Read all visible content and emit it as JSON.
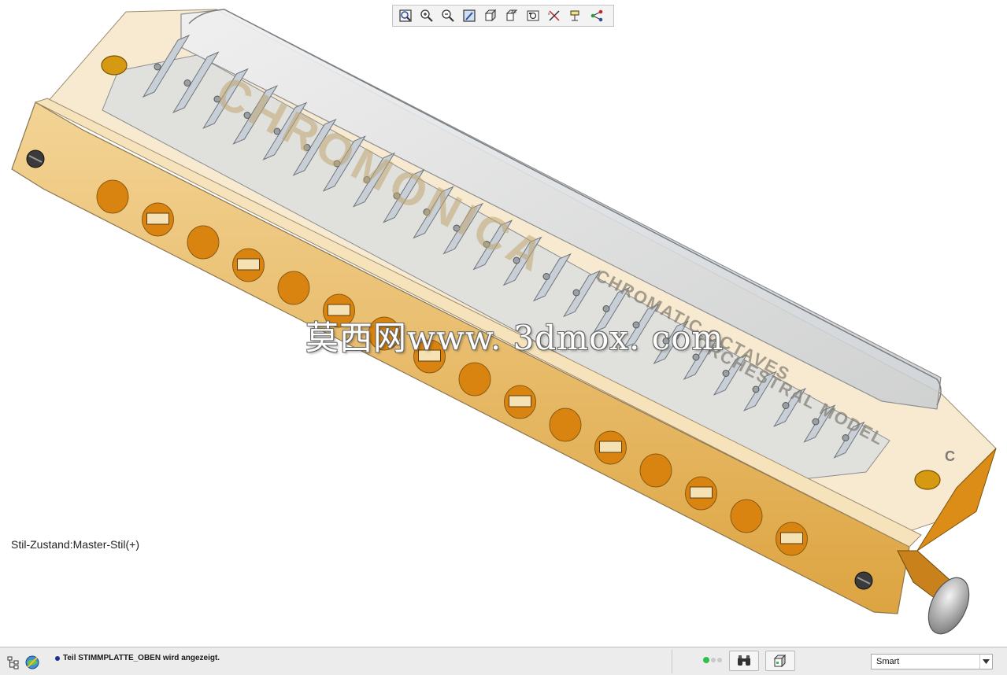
{
  "toolbar": {
    "buttons": [
      {
        "name": "refit-icon"
      },
      {
        "name": "zoom-in-icon"
      },
      {
        "name": "zoom-out-icon"
      },
      {
        "name": "repaint-icon"
      },
      {
        "name": "display-style-icon"
      },
      {
        "name": "saved-orientations-icon"
      },
      {
        "name": "view-manager-icon"
      },
      {
        "name": "datum-display-icon"
      },
      {
        "name": "annotation-display-icon"
      },
      {
        "name": "spin-center-icon"
      }
    ]
  },
  "viewport": {
    "style_state": "Stil-Zustand:Master-Stil(+)",
    "watermark": "莫西网www. 3dmox. com",
    "model_text": {
      "brand_lettering": "CHROMONICA",
      "lettering_line1": "CHROMATIC OCTAVES",
      "lettering_line2": "ORCHESTRAL MODEL",
      "key_letter": "C"
    }
  },
  "statusbar": {
    "message": "Teil STIMMPLATTE_OBEN wird angezeigt.",
    "filter_value": "Smart",
    "colors": {
      "message_dot": "#1c2f8a",
      "light_active": "#2ec04a",
      "light_inactive": "#c9c9c9"
    }
  },
  "colors": {
    "model_body": "#e4a83a",
    "model_cover": "#d6d9dc",
    "hole_fill": "#d98410",
    "reed_plate": "#c8cfd6"
  }
}
